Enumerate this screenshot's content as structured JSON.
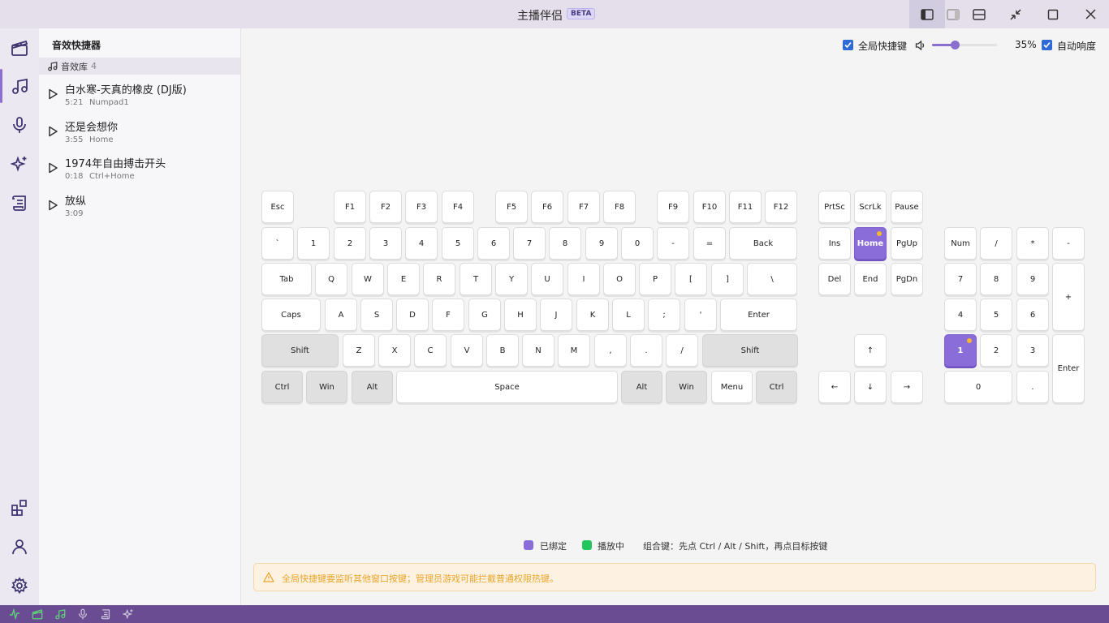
{
  "app": {
    "title": "主播伴侣",
    "badge": "BETA"
  },
  "window_controls": [
    {
      "icon": "sidebar-left-icon",
      "active": true
    },
    {
      "icon": "sidebar-right-icon",
      "active": false
    },
    {
      "icon": "panel-bottom-icon",
      "active": false
    },
    {
      "icon": "compact-icon",
      "active": false
    },
    {
      "icon": "maximize-icon",
      "active": false
    },
    {
      "icon": "close-icon",
      "active": false
    }
  ],
  "rail": {
    "top": [
      {
        "icon": "clapperboard-icon",
        "active": false
      },
      {
        "icon": "music-note-icon",
        "active": true
      },
      {
        "icon": "microphone-icon",
        "active": false
      },
      {
        "icon": "sparkles-icon",
        "active": false
      },
      {
        "icon": "scroll-icon",
        "active": false
      }
    ],
    "bottom": [
      {
        "icon": "widgets-icon"
      },
      {
        "icon": "user-icon"
      },
      {
        "icon": "settings-gear-icon"
      }
    ]
  },
  "panel": {
    "title": "音效快捷器",
    "library": {
      "label": "音效库",
      "count": "4"
    },
    "tracks": [
      {
        "title": "白水寒-天真的橡皮 (DJ版)",
        "duration": "5:21",
        "hotkey": "Numpad1"
      },
      {
        "title": "还是会想你",
        "duration": "3:55",
        "hotkey": "Home"
      },
      {
        "title": "1974年自由搏击开头",
        "duration": "0:18",
        "hotkey": "Ctrl+Home"
      },
      {
        "title": "放纵",
        "duration": "3:09",
        "hotkey": ""
      }
    ]
  },
  "controls": {
    "global_hotkeys_label": "全局快捷键",
    "global_hotkeys_checked": true,
    "volume_percent": 35,
    "volume_label": "35%",
    "auto_loudness_label": "自动响度",
    "auto_loudness_checked": true
  },
  "keyboard": {
    "bound_color": "#8b6dda",
    "playing_color": "#22c55e",
    "bound_keys": [
      "Home",
      "Numpad1"
    ],
    "main_rows": [
      [
        "Esc",
        "F1",
        "F2",
        "F3",
        "F4",
        "F5",
        "F6",
        "F7",
        "F8",
        "F9",
        "F10",
        "F11",
        "F12"
      ],
      [
        "`",
        "1",
        "2",
        "3",
        "4",
        "5",
        "6",
        "7",
        "8",
        "9",
        "0",
        "-",
        "=",
        "Back"
      ],
      [
        "Tab",
        "Q",
        "W",
        "E",
        "R",
        "T",
        "Y",
        "U",
        "I",
        "O",
        "P",
        "[",
        "]",
        "\\"
      ],
      [
        "Caps",
        "A",
        "S",
        "D",
        "F",
        "G",
        "H",
        "J",
        "K",
        "L",
        ";",
        "'",
        "Enter"
      ],
      [
        "Shift",
        "Z",
        "X",
        "C",
        "V",
        "B",
        "N",
        "M",
        ",",
        ".",
        "/",
        "Shift"
      ],
      [
        "Ctrl",
        "Win",
        "Alt",
        "Space",
        "Alt",
        "Win",
        "Menu",
        "Ctrl"
      ]
    ],
    "nav_keys": [
      "PrtSc",
      "ScrLk",
      "Pause",
      "Ins",
      "Home",
      "PgUp",
      "Del",
      "End",
      "PgDn",
      "↑",
      "←",
      "↓",
      "→"
    ],
    "numpad_keys": [
      "Num",
      "/",
      "*",
      "-",
      "7",
      "8",
      "9",
      "+",
      "4",
      "5",
      "6",
      "1",
      "2",
      "3",
      "Enter",
      "0",
      "."
    ]
  },
  "legend": {
    "bound_label": "已绑定",
    "playing_label": "播放中",
    "combo_hint": "组合键：先点 Ctrl / Alt / Shift，再点目标按键"
  },
  "warning": {
    "text": "全局快捷键要监听其他窗口按键；管理员游戏可能拦截普通权限热键。"
  },
  "status_bar": {
    "icons": [
      "activity-icon",
      "clapperboard-icon",
      "music-note-icon",
      "microphone-icon",
      "scroll-icon",
      "sparkles-icon"
    ],
    "icon_color": "#5fd07a"
  }
}
